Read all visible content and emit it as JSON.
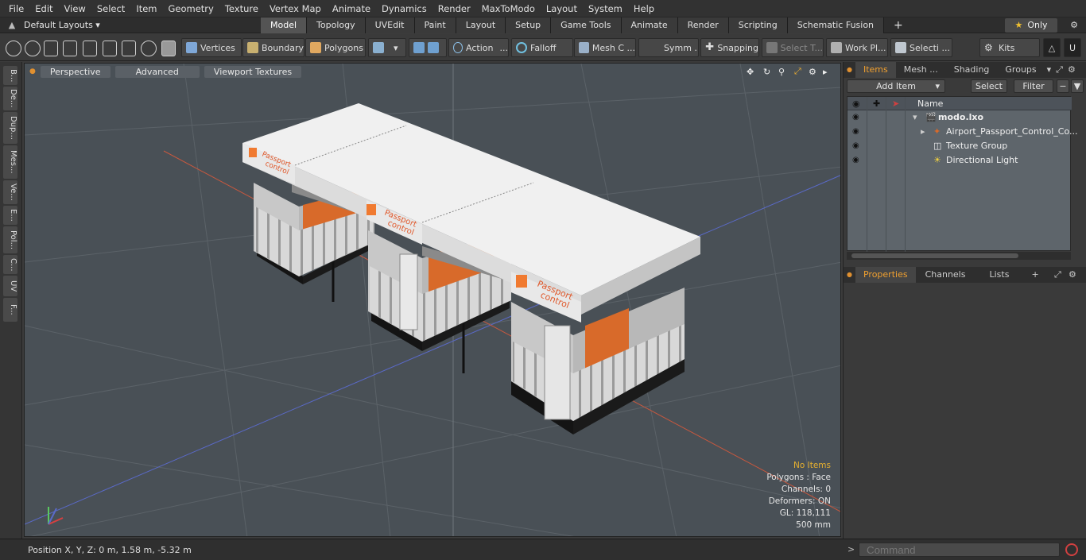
{
  "menu": [
    "File",
    "Edit",
    "View",
    "Select",
    "Item",
    "Geometry",
    "Texture",
    "Vertex Map",
    "Animate",
    "Dynamics",
    "Render",
    "MaxToModo",
    "Layout",
    "System",
    "Help"
  ],
  "layout_selector": "Default Layouts ▾",
  "layout_tabs": [
    "Model",
    "Topology",
    "UVEdit",
    "Paint",
    "Layout",
    "Setup",
    "Game Tools",
    "Animate",
    "Render",
    "Scripting",
    "Schematic Fusion"
  ],
  "active_tab": "Model",
  "only_button": "Only",
  "toolbar": {
    "vertices": "Vertices",
    "boundary": "Boundary",
    "polygons": "Polygons",
    "action": "Action",
    "falloff": "Falloff",
    "mesh": "Mesh C ...",
    "symmetry": "Symm ...",
    "snapping": "Snapping",
    "select_tool": "Select T...",
    "workplane": "Work Pl...",
    "selection": "Selecti ...",
    "kits": "Kits"
  },
  "left_tabs": [
    "B...",
    "De...",
    "Dup...",
    "Mes...",
    "Ve...",
    "E...",
    "Pol...",
    "C...",
    "UV",
    "F..."
  ],
  "viewport": {
    "perspective": "Perspective",
    "advanced": "Advanced",
    "textures": "Viewport Textures",
    "sign_text_1": "Passport",
    "sign_text_2": "control",
    "info": {
      "no_items": "No Items",
      "polygons": "Polygons : Face",
      "channels": "Channels: 0",
      "deformers": "Deformers: ON",
      "gl": "GL: 118,111",
      "scale": "500 mm"
    }
  },
  "status": {
    "position": "Position X, Y, Z:   0 m, 1.58 m, -5.32 m",
    "command_placeholder": "Command"
  },
  "items_panel": {
    "tabs": [
      "Items",
      "Mesh ...",
      "Shading",
      "Groups"
    ],
    "add_item": "Add Item",
    "select": "Select",
    "filter": "Filter",
    "name_header": "Name",
    "rows": [
      {
        "label": "modo.lxo"
      },
      {
        "label": "Airport_Passport_Control_Co..."
      },
      {
        "label": "Texture Group"
      },
      {
        "label": "Directional Light"
      }
    ]
  },
  "props_panel": {
    "tabs": [
      "Properties",
      "Channels",
      "Lists"
    ]
  },
  "colors": {
    "accent": "#f0a030",
    "viewport_bg": "#495056",
    "booth_orange": "#d86a2a"
  }
}
